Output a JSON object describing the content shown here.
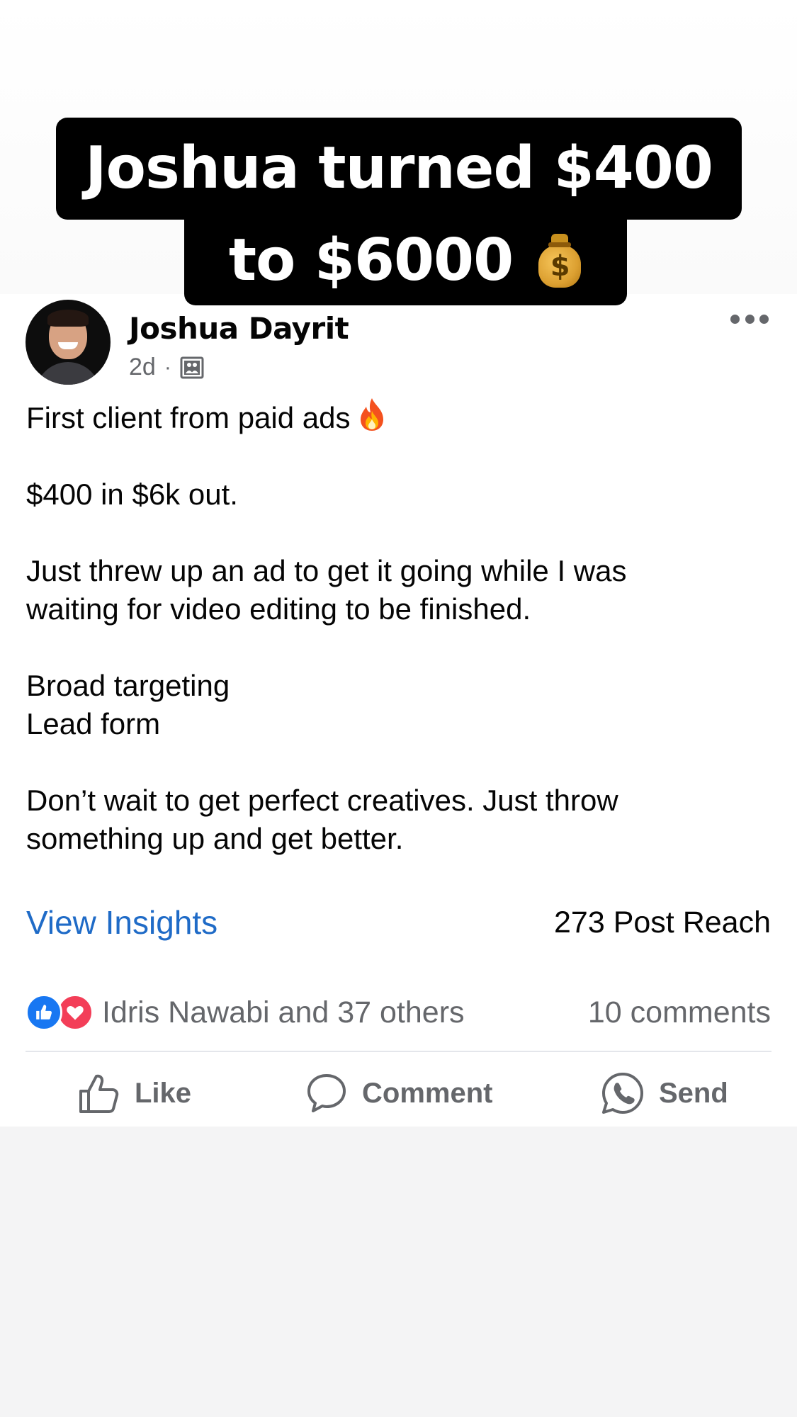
{
  "caption": {
    "line1": "Joshua turned $400",
    "line2": "to $6000",
    "bag_symbol": "$"
  },
  "post": {
    "author": "Joshua Dayrit",
    "time": "2d",
    "separator": "·",
    "audience_icon": "group-audience-icon",
    "paragraphs": [
      "First client from paid ads",
      "$400 in $6k out.",
      "Just threw up an ad to get it going while I was\nwaiting for video editing to be finished.",
      "Broad targeting\nLead form",
      "Don’t wait to get perfect creatives. Just throw\nsomething up and get better."
    ],
    "view_insights": "View Insights",
    "post_reach": "273 Post Reach",
    "reactions_text": "Idris Nawabi and 37 others",
    "comments": "10 comments"
  },
  "actions": {
    "like": "Like",
    "comment": "Comment",
    "send": "Send"
  },
  "colors": {
    "link_blue": "#1f6bc7",
    "like_blue": "#1877f2",
    "love_red": "#f33e58",
    "secondary_text": "#65676b",
    "caption_bg": "#000000"
  }
}
